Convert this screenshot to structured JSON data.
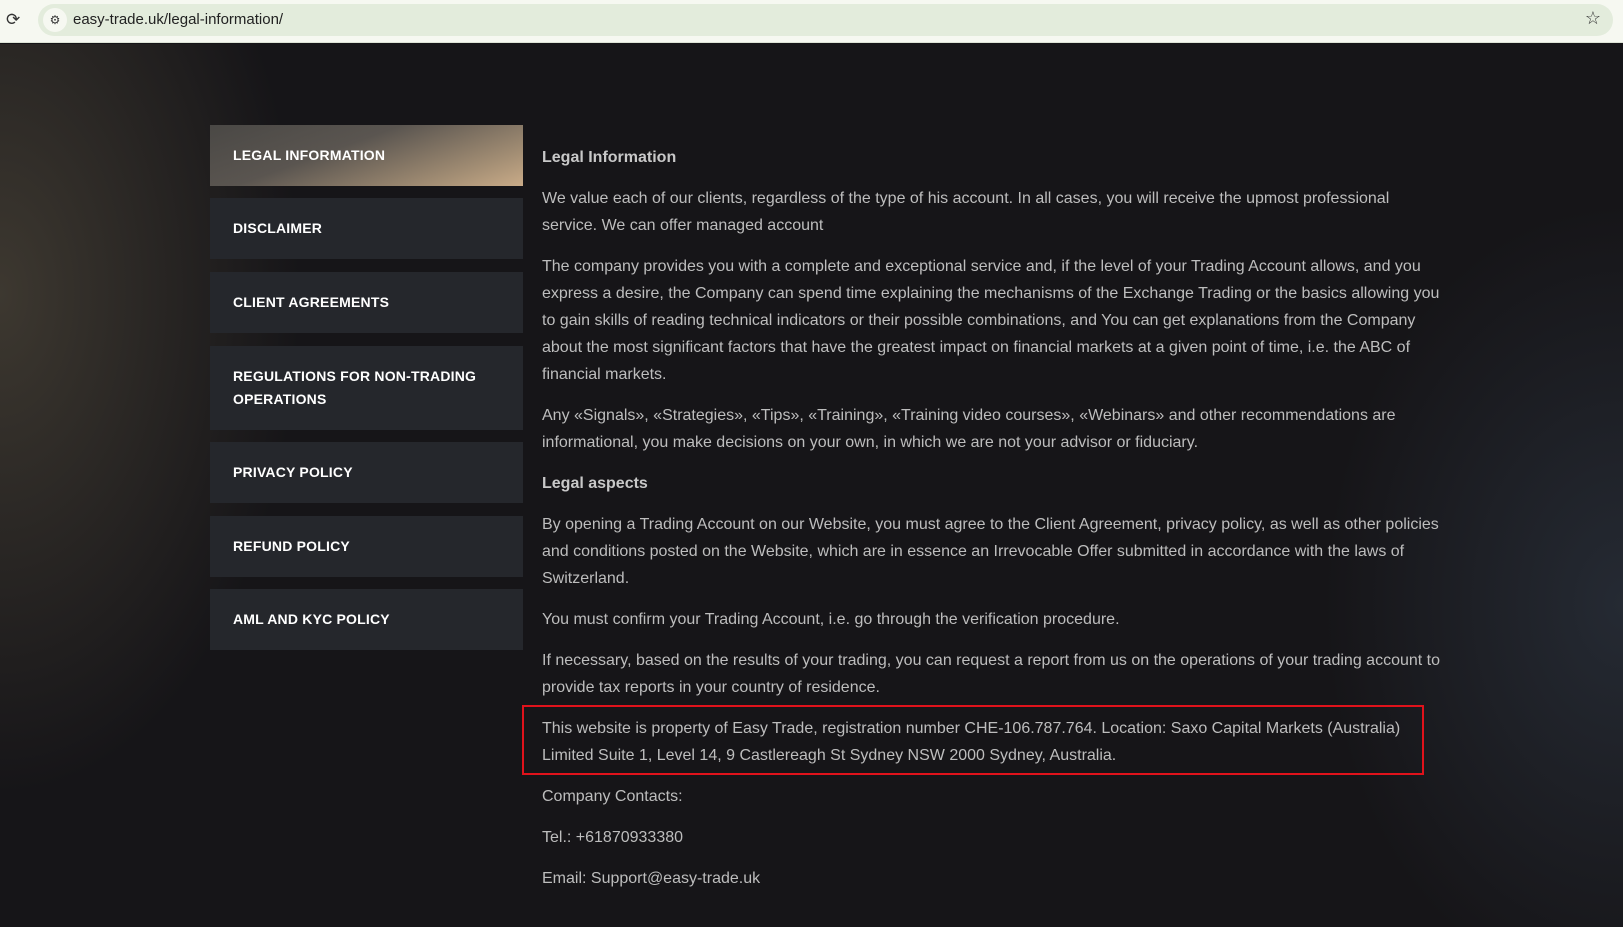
{
  "browser": {
    "url": "easy-trade.uk/legal-information/"
  },
  "sidebar": {
    "items": [
      {
        "label": "LEGAL INFORMATION",
        "active": true
      },
      {
        "label": "DISCLAIMER"
      },
      {
        "label": "CLIENT AGREEMENTS"
      },
      {
        "label": "REGULATIONS FOR NON-TRADING OPERATIONS"
      },
      {
        "label": "PRIVACY POLICY"
      },
      {
        "label": "REFUND POLICY"
      },
      {
        "label": "AML AND KYC POLICY"
      }
    ]
  },
  "content": {
    "title": "Legal Information",
    "p1": "We value each of our clients, regardless of the type of his account. In all cases, you will receive the upmost professional service. We can offer managed account",
    "p2": "The company provides you with a complete and exceptional service and, if the level of your Trading Account allows, and you express a desire, the Company can spend time explaining the mechanisms of the Exchange Trading or the basics allowing you to gain skills of reading technical indicators or their possible combinations, and You can get explanations from the Company about the most significant factors that have the greatest impact on financial markets at a given point of time, i.e. the ABC of financial markets.",
    "p3": "Any «Signals», «Strategies», «Tips», «Training», «Training video courses», «Webinars» and other recommendations are informational, you make decisions on your own, in which we are not your advisor or fiduciary.",
    "subtitle": "Legal aspects",
    "p4": "By opening a Trading Account on our Website, you must agree to the Client Agreement, privacy policy, as well as other policies and conditions posted on the Website, which are in essence an Irrevocable Offer submitted in accordance with the laws of Switzerland.",
    "p5": "You must confirm your Trading Account, i.e. go through the verification procedure.",
    "p6": "If necessary, based on the results of your trading, you can request a report from us on the operations of your trading account to provide tax reports in your country of residence.",
    "p7": "This website is property of Easy Trade, registration number CHE-106.787.764. Location: Saxo Capital Markets (Australia) Limited Suite 1, Level 14, 9 Castlereagh St Sydney NSW 2000 Sydney, Australia.",
    "contacts": "Company Contacts:",
    "tel": "Tel.: +61870933380",
    "email": "Email: Support@easy-trade.uk"
  }
}
